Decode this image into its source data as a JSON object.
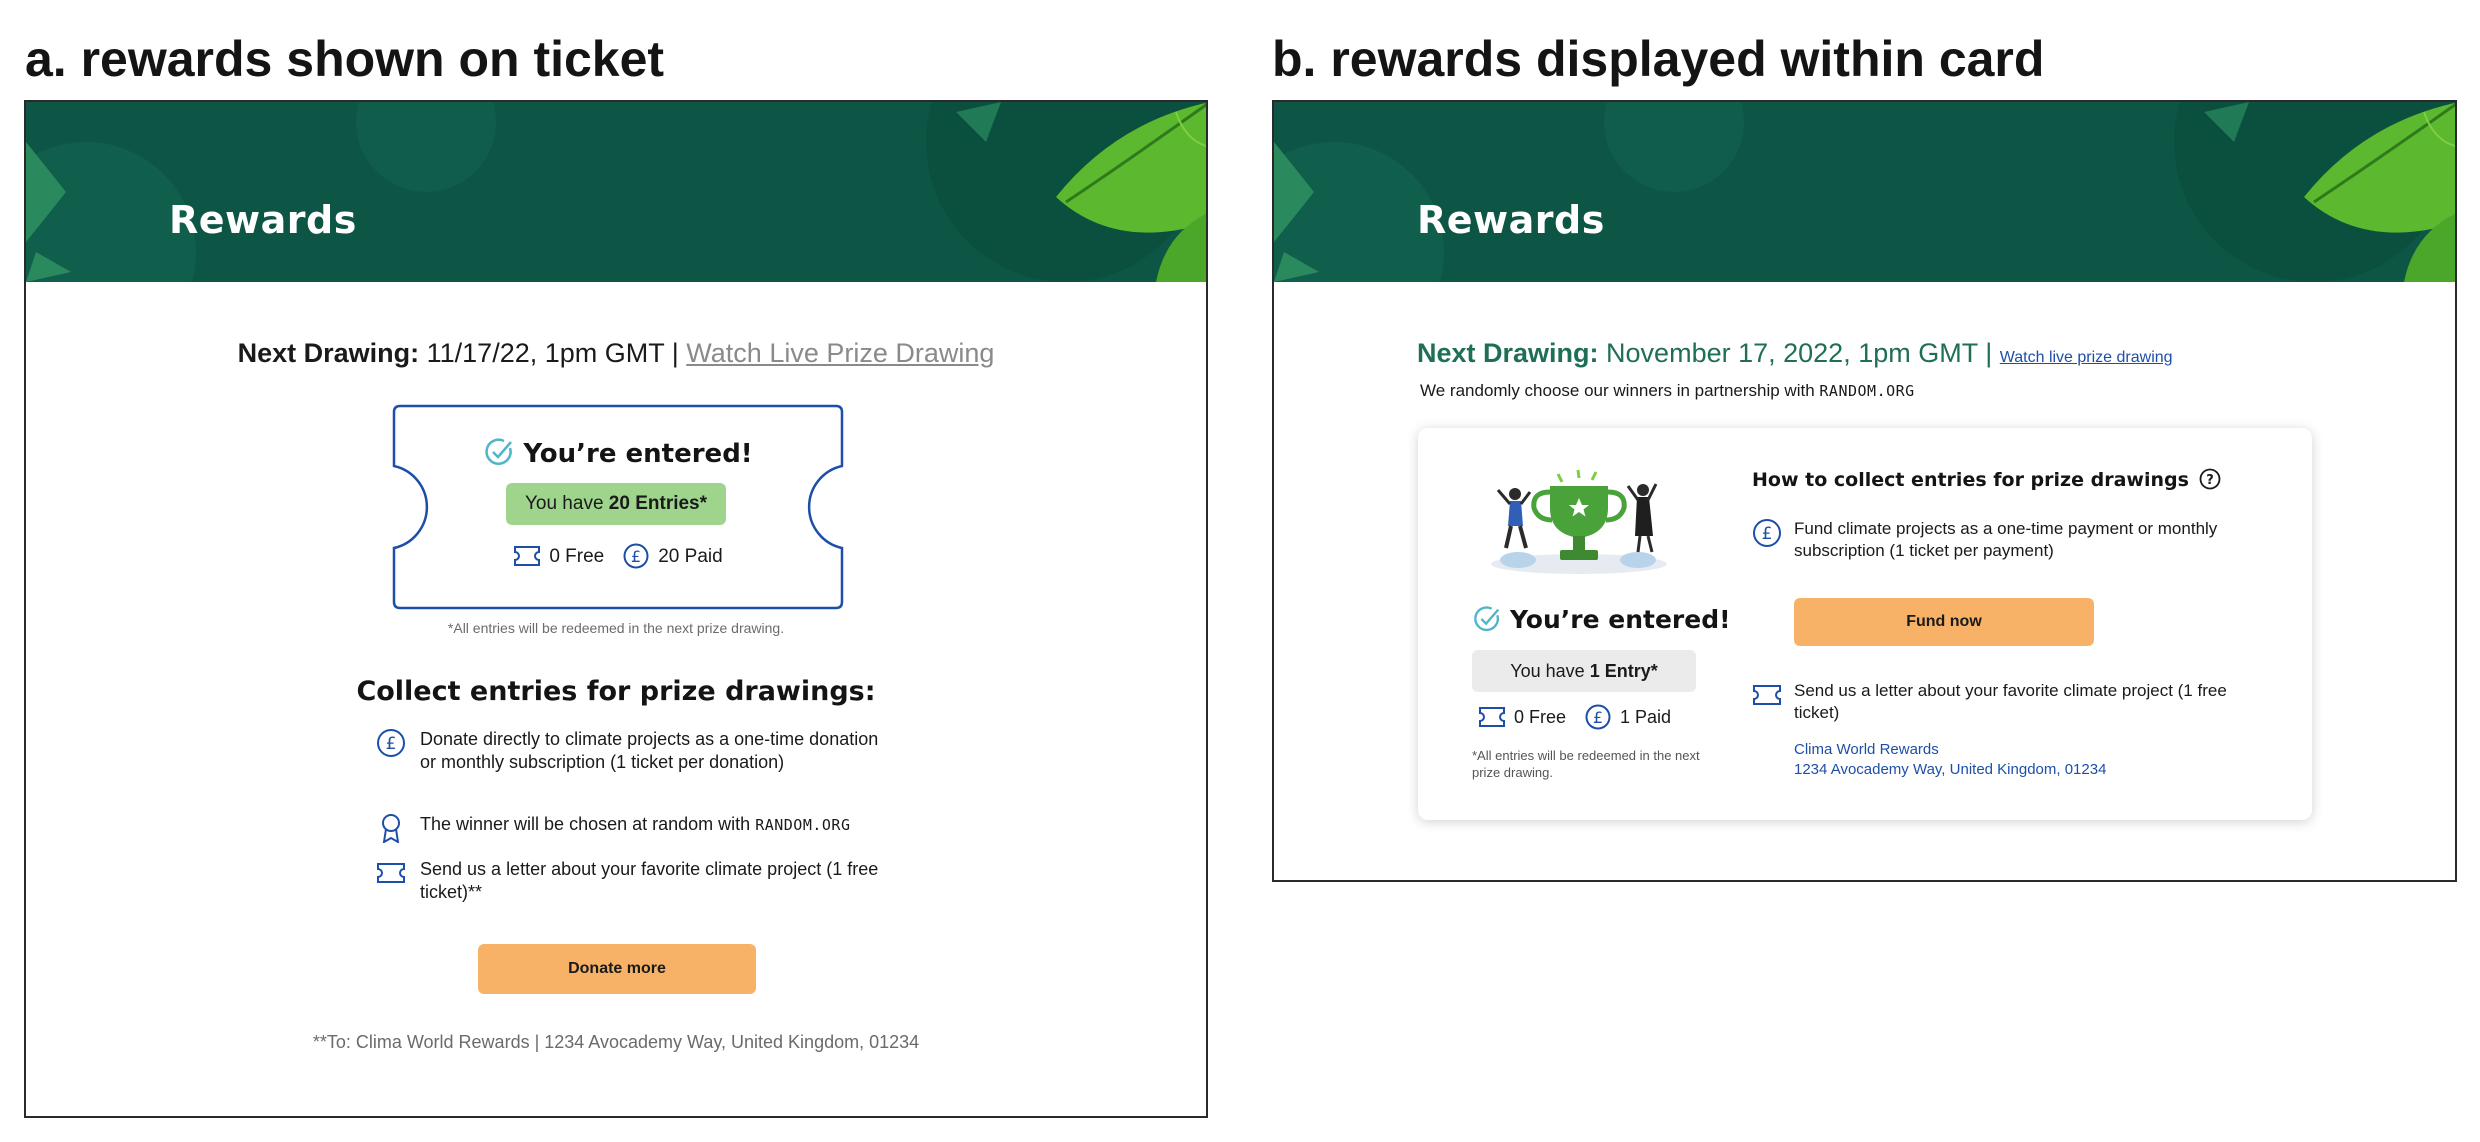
{
  "panel_a": {
    "heading": "a. rewards shown on ticket",
    "banner_title": "Rewards",
    "next_drawing_label": "Next Drawing:",
    "next_drawing_value": "11/17/22, 1pm GMT |",
    "watch_link": "Watch Live Prize Drawing",
    "entered_title": "You’re entered!",
    "entries_prefix": "You have",
    "entries_value": "20 Entries*",
    "free_count": "0 Free",
    "paid_count": "20 Paid",
    "footnote": "*All entries will be redeemed in the next prize drawing.",
    "collect_title": "Collect entries for prize drawings:",
    "items": [
      {
        "icon": "pound-coin-icon",
        "text": "Donate directly to climate projects as a one-time donation or monthly subscription (1 ticket per donation)"
      },
      {
        "icon": "award-ribbon-icon",
        "text": "The winner will be chosen at random with",
        "mono": "RANDOM.ORG"
      },
      {
        "icon": "ticket-icon",
        "text": "Send us a letter about your favorite climate project (1 free ticket)**"
      }
    ],
    "button_label": "Donate more",
    "address": "**To: Clima World Rewards | 1234 Avocademy Way, United Kingdom, 01234"
  },
  "panel_b": {
    "heading": "b. rewards displayed within card",
    "banner_title": "Rewards",
    "next_drawing_label": "Next Drawing:",
    "next_drawing_value": "November 17, 2022, 1pm GMT |",
    "watch_link": "Watch live prize drawing",
    "random_text": "We randomly choose our winners in partnership with",
    "random_mono": "RANDOM.ORG",
    "entered_title": "You’re entered!",
    "entries_prefix": "You have",
    "entries_value": "1 Entry*",
    "free_count": "0 Free",
    "paid_count": "1 Paid",
    "footnote": "*All entries will be redeemed in the next prize drawing.",
    "how_title": "How to collect entries for prize drawings",
    "item_fund": "Fund climate projects as a one-time payment or monthly subscription (1 ticket per payment)",
    "button_label": "Fund now",
    "item_letter": "Send us a letter about your favorite climate project (1 free ticket)",
    "address_name": "Clima World Rewards",
    "address_line": "1234 Avocademy Way, United Kingdom, 01234"
  },
  "colors": {
    "banner": "#0d5645",
    "accent_green": "#1f6e58",
    "button": "#f7b267",
    "pill_green": "#9ed48c",
    "icon_blue": "#1d4fa8"
  }
}
